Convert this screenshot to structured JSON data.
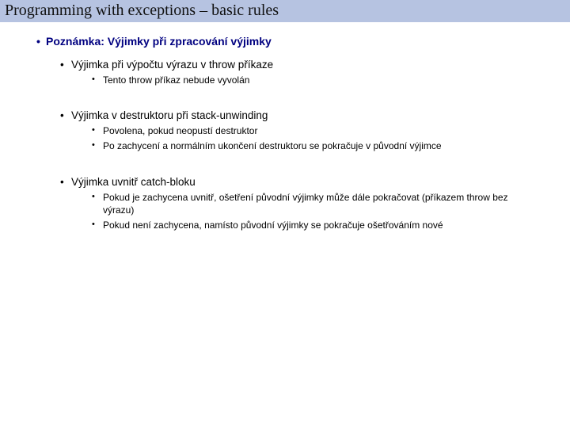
{
  "title": "Programming with exceptions – basic rules",
  "note_heading": "Poznámka: Výjimky při zpracování výjimky",
  "sections": [
    {
      "heading": "Výjimka při výpočtu výrazu v throw příkaze",
      "items": [
        "Tento throw příkaz nebude vyvolán"
      ]
    },
    {
      "heading": "Výjimka v destruktoru při stack-unwinding",
      "items": [
        "Povolena, pokud neopustí destruktor",
        "Po zachycení a normálním ukončení destruktoru se pokračuje v původní výjimce"
      ]
    },
    {
      "heading": "Výjimka uvnitř catch-bloku",
      "items": [
        "Pokud je zachycena uvnitř, ošetření původní výjimky může dále pokračovat (příkazem throw bez výrazu)",
        "Pokud není zachycena, namísto původní výjimky se pokračuje ošetřováním nové"
      ]
    }
  ]
}
